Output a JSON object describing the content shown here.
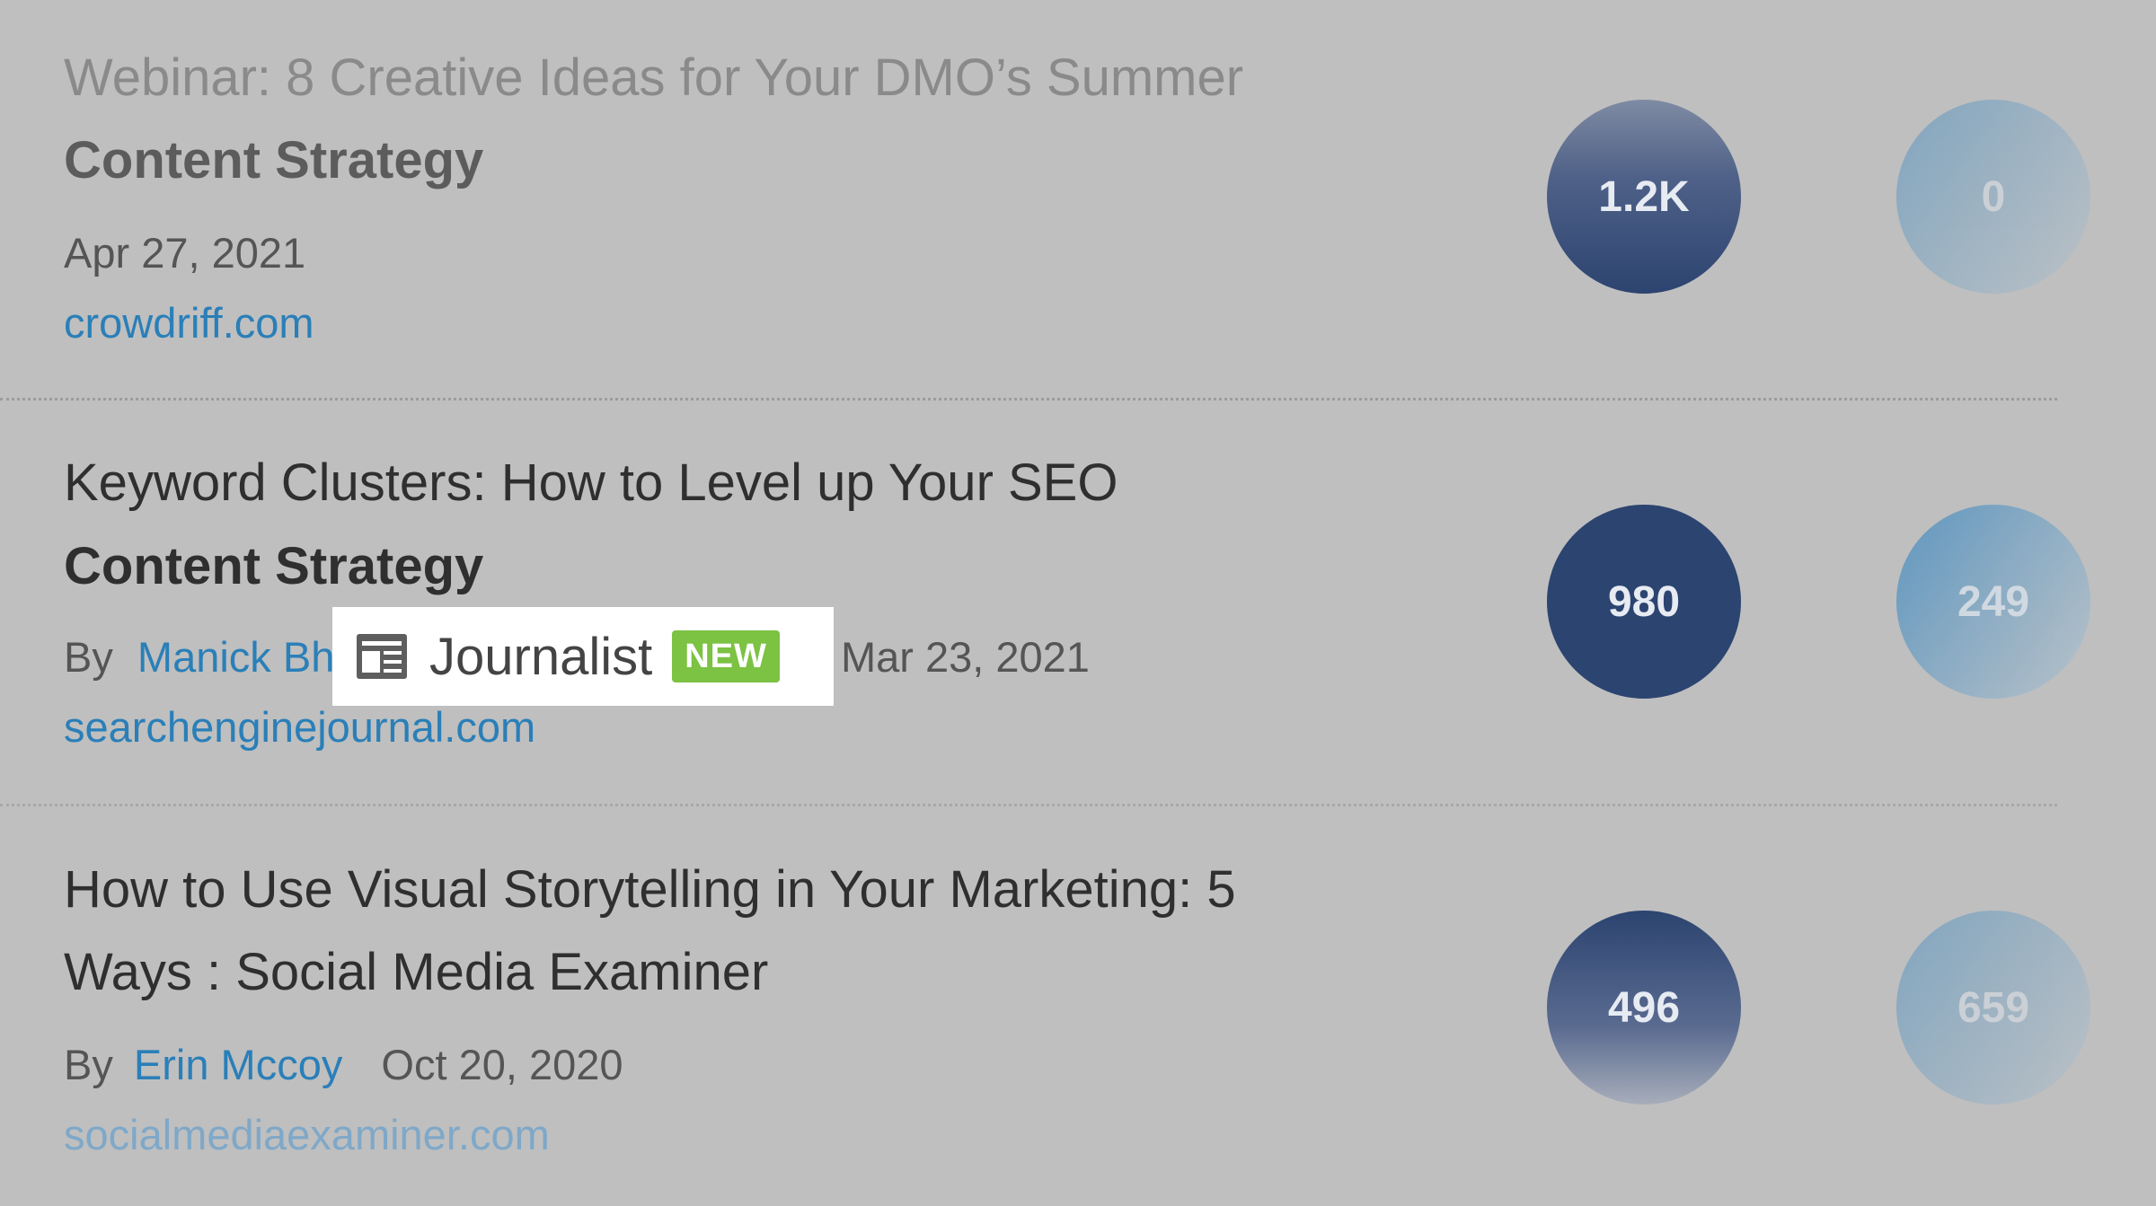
{
  "articles": [
    {
      "title_line1": "Webinar: 8 Creative Ideas for Your DMO’s Summer",
      "title_line2": "Content Strategy",
      "date": "Apr 27, 2021",
      "domain": "crowdriff.com",
      "metric_a": "1.2K",
      "metric_b": "0"
    },
    {
      "title_line1": "Keyword Clusters: How to Level up Your SEO",
      "title_line2": "Content Strategy",
      "by": "By",
      "author": "Manick Bha",
      "date": "Mar 23, 2021",
      "domain": "searchenginejournal.com",
      "metric_a": "980",
      "metric_b": "249"
    },
    {
      "title_line1": "How to Use Visual Storytelling in Your Marketing: 5",
      "title_line2": "Ways : Social Media Examiner",
      "by": "By",
      "author": "Erin Mccoy",
      "date": "Oct 20, 2020",
      "domain": "socialmediaexaminer.com",
      "metric_a": "496",
      "metric_b": "659"
    }
  ],
  "journalist_popover": {
    "icon": "newspaper-icon",
    "label": "Journalist",
    "badge": "NEW",
    "badge_color": "#7cc243"
  },
  "colors": {
    "background": "#bfbfbf",
    "link": "#2a7fb8",
    "metric_dark": "#2c4470",
    "metric_light": "#4e8fbf"
  }
}
